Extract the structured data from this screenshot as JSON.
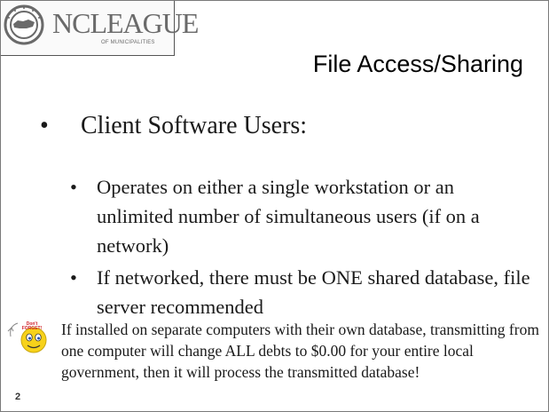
{
  "logo": {
    "brand_text": "NCLEAGUE",
    "sub_text": "OF MUNICIPALITIES"
  },
  "title": "File Access/Sharing",
  "bullets": {
    "level1": {
      "marker": "•",
      "text": "Client Software Users:"
    },
    "level2": [
      {
        "marker": "•",
        "text": "Operates on either a single workstation or an unlimited number of simultaneous users (if on a network)"
      },
      {
        "marker": "•",
        "text": "If networked, there must be ONE shared database, file server recommended"
      }
    ]
  },
  "note": {
    "icon": "dont-forget-smiley-icon",
    "icon_text": "Don't FORGET!",
    "text": "If installed on separate computers with their own database, transmitting from one computer will change ALL debts to $0.00 for your entire local government, then it will process the transmitted database!"
  },
  "page_number": "2",
  "colors": {
    "logo_gray": "#6a6a6a",
    "smiley_yellow": "#f7d21a",
    "smiley_text_red": "#d0202a"
  }
}
